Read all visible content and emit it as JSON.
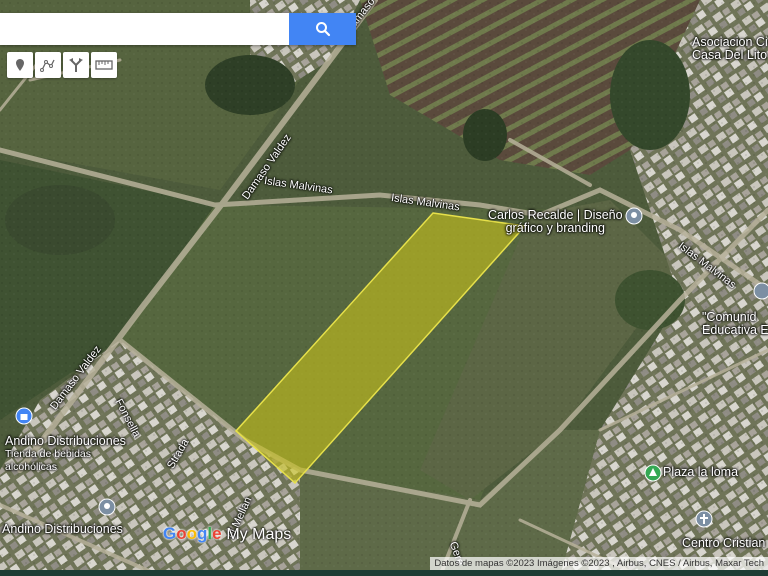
{
  "search": {
    "placeholder": "",
    "value": ""
  },
  "icons": {
    "search": "search-icon",
    "tools": [
      "marker-icon",
      "line-icon",
      "route-icon",
      "ruler-icon"
    ]
  },
  "roads": {
    "damaso_valdez_top": "Damaso Valdez",
    "damaso_valdez_mid": "Damaso Valdez",
    "damaso_valdez_low": "Damaso Valdez",
    "islas_malvinas_1": "Islas Malvinas",
    "islas_malvinas_2": "Islas Malvinas",
    "islas_malvinas_3": "Islas Malvinas",
    "fonsella": "Fonsella",
    "strada": "Strada",
    "mellan": "el Mellan",
    "gere": "Gere"
  },
  "places": {
    "asociacion_line1": "Asociacion Ci",
    "asociacion_line2": "Casa Del Lito",
    "carlos_line1": "Carlos Recalde | Diseño",
    "carlos_line2": "gráfico y branding",
    "comunidad_line1": "\"Comunid",
    "comunidad_line2": "Educativa El Omb",
    "andino1_name": "Andino Distribuciones",
    "andino1_sub1": "Tienda de bebidas",
    "andino1_sub2": "alcohólicas",
    "andino2_name": "Andino Distribuciones",
    "plaza": "Plaza la loma",
    "centro": "Centro Cristian"
  },
  "branding": {
    "google": "Google",
    "mymaps": "My Maps"
  },
  "footer": "Datos de mapas ©2023 Imágenes ©2023 , Airbus, CNES / Airbus, Maxar Tech",
  "colors": {
    "search_button": "#4285f4",
    "highlight_fill": "#c8c21a",
    "highlight_stroke": "#e6e04a"
  }
}
